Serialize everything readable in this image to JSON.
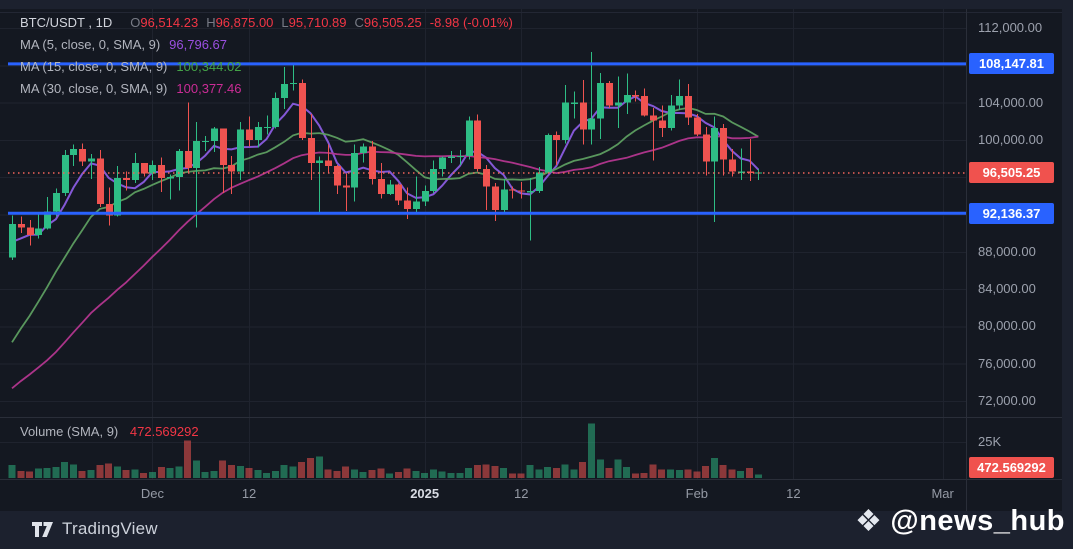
{
  "legend": {
    "symbol_line": "BTC/USDT , 1D",
    "ohlc": {
      "o_key": "O",
      "o": "96,514.23",
      "h_key": "H",
      "h": "96,875.00",
      "l_key": "L",
      "l": "95,710.89",
      "c_key": "C",
      "c": "96,505.25",
      "change": "-8.98 (-0.01%)"
    },
    "ma_rows": [
      {
        "label": "MA (5, close, 0, SMA, 9)",
        "value": "96,796.67",
        "color": "#9a4fe0"
      },
      {
        "label": "MA (15, close, 0, SMA, 9)",
        "value": "100,344.02",
        "color": "#44a248"
      },
      {
        "label": "MA (30, close, 0, SMA, 9)",
        "value": "100,377.46",
        "color": "#cb2c96"
      }
    ]
  },
  "volume_legend": {
    "label": "Volume (SMA, 9)",
    "value": "472.569292"
  },
  "footer": {
    "brand": "TradingView",
    "watermark": "@news_hub"
  },
  "colors": {
    "background": "#141821",
    "outer_background": "#1c212e",
    "grid": "#1f232e",
    "separator": "#2a2e39",
    "candle_up": "#2ebd85",
    "candle_down": "#ef5350",
    "volume_up": "rgba(46,189,133,0.50)",
    "volume_down": "rgba(239,83,80,0.55)",
    "ma5": "#8a5ce0",
    "ma15": "#5d9e61",
    "ma30": "#b3368f",
    "price_line_blue": "#2962ff",
    "last_price_red": "#f0524e",
    "legend_red": "#f23645",
    "axis_text": "#9ca1ad"
  },
  "chart_data": {
    "type": "candlestick+volume",
    "symbol": "BTC/USDT",
    "interval": "1D",
    "note_units": "prices in thousands of USDT; volumes in K",
    "price_axis_visible_range": [
      72000,
      112000
    ],
    "grid_price_levels": [
      112,
      108,
      104,
      100,
      96,
      92,
      88,
      84,
      80,
      76,
      72
    ],
    "price_ticks": [
      {
        "label": "112,000.00",
        "price": 112000
      },
      {
        "label": "104,000.00",
        "price": 104000
      },
      {
        "label": "100,000.00",
        "price": 100000
      },
      {
        "label": "88,000.00",
        "price": 88000
      },
      {
        "label": "84,000.00",
        "price": 84000
      },
      {
        "label": "80,000.00",
        "price": 80000
      },
      {
        "label": "76,000.00",
        "price": 76000
      },
      {
        "label": "72,000.00",
        "price": 72000
      }
    ],
    "price_lines": [
      {
        "label": "108,147.81",
        "price": 108147.81
      },
      {
        "label": "92,136.37",
        "price": 92136.37
      }
    ],
    "last_price": {
      "label": "96,505.25",
      "price": 96505.25
    },
    "volume_axis_tick": {
      "label": "25K",
      "value": 25
    },
    "volume_axis_label": "472.569292",
    "x_ticks": [
      {
        "label": "Dec",
        "i": 16,
        "strong": false
      },
      {
        "label": "12",
        "i": 27,
        "strong": false
      },
      {
        "label": "2025",
        "i": 47,
        "strong": true
      },
      {
        "label": "12",
        "i": 58,
        "strong": false
      },
      {
        "label": "Feb",
        "i": 78,
        "strong": false
      },
      {
        "label": "12",
        "i": 89,
        "strong": false
      },
      {
        "label": "Mar",
        "i": 106,
        "strong": false
      }
    ],
    "ma_periods": [
      5,
      15,
      30
    ],
    "pre_closes": [
      67.6,
      67.4,
      68.4,
      68.4,
      69.0,
      67.4,
      67.4,
      66.7,
      67.0,
      66.6,
      67.9,
      68.2,
      69.9,
      72.3,
      70.2,
      69.5,
      68.7,
      69.3,
      67.8,
      68.8,
      69.4,
      75.6,
      76.0,
      76.7,
      76.5,
      80.4,
      88.7,
      87.9,
      90.4,
      87.3
    ],
    "candles": [
      [
        87.4,
        91.9,
        87.1,
        91.0,
        9
      ],
      [
        91.0,
        91.8,
        90.0,
        90.6,
        5
      ],
      [
        90.6,
        91.4,
        88.7,
        89.8,
        4.5
      ],
      [
        89.8,
        92.0,
        89.4,
        90.5,
        6.5
      ],
      [
        90.5,
        93.9,
        90.4,
        92.3,
        7
      ],
      [
        92.3,
        94.8,
        91.8,
        94.3,
        7.5
      ],
      [
        94.3,
        98.9,
        94.0,
        98.4,
        11
      ],
      [
        98.4,
        99.5,
        97.2,
        99.0,
        9.5
      ],
      [
        99.0,
        99.6,
        97.2,
        97.7,
        5
      ],
      [
        97.7,
        98.5,
        95.8,
        98.0,
        5.5
      ],
      [
        98.0,
        98.9,
        92.8,
        93.1,
        9
      ],
      [
        93.1,
        94.9,
        90.8,
        91.9,
        10
      ],
      [
        91.9,
        97.2,
        91.8,
        95.9,
        8
      ],
      [
        95.9,
        96.6,
        94.6,
        95.7,
        5.5
      ],
      [
        95.7,
        98.6,
        95.4,
        97.5,
        6
      ],
      [
        97.5,
        97.5,
        96.1,
        96.4,
        3.5
      ],
      [
        96.4,
        97.8,
        95.7,
        97.3,
        4
      ],
      [
        97.3,
        98.1,
        94.4,
        95.9,
        7.5
      ],
      [
        95.9,
        96.3,
        93.6,
        96.0,
        7
      ],
      [
        96.0,
        99.0,
        94.6,
        98.8,
        8
      ],
      [
        98.8,
        104.0,
        96.5,
        97.0,
        26
      ],
      [
        97.0,
        101.9,
        90.6,
        99.9,
        12
      ],
      [
        99.9,
        100.4,
        98.8,
        99.9,
        4
      ],
      [
        99.9,
        101.4,
        98.7,
        101.2,
        5
      ],
      [
        101.2,
        101.2,
        94.3,
        97.3,
        12
      ],
      [
        97.3,
        98.3,
        94.2,
        96.6,
        9
      ],
      [
        96.6,
        101.9,
        95.7,
        101.1,
        8.5
      ],
      [
        101.1,
        102.5,
        99.3,
        100.0,
        7
      ],
      [
        100.0,
        101.9,
        99.2,
        101.4,
        5.5
      ],
      [
        101.4,
        102.6,
        100.6,
        101.4,
        3.5
      ],
      [
        101.4,
        105.1,
        101.2,
        104.5,
        5
      ],
      [
        104.5,
        107.8,
        103.3,
        106.0,
        9
      ],
      [
        106.0,
        108.3,
        105.3,
        106.1,
        8
      ],
      [
        106.1,
        106.5,
        100.0,
        100.2,
        11
      ],
      [
        100.2,
        102.8,
        95.7,
        97.5,
        14
      ],
      [
        97.5,
        98.2,
        92.2,
        97.8,
        15
      ],
      [
        97.8,
        99.5,
        96.4,
        97.2,
        6
      ],
      [
        97.2,
        97.3,
        94.2,
        95.1,
        5
      ],
      [
        95.1,
        96.4,
        92.4,
        94.9,
        8
      ],
      [
        94.9,
        99.5,
        93.4,
        98.6,
        6
      ],
      [
        98.6,
        99.6,
        97.6,
        99.3,
        4
      ],
      [
        99.3,
        99.9,
        95.2,
        95.8,
        5.5
      ],
      [
        95.8,
        97.5,
        93.7,
        94.2,
        6.5
      ],
      [
        94.2,
        95.7,
        94.1,
        95.2,
        3
      ],
      [
        95.2,
        95.3,
        93.0,
        93.5,
        4
      ],
      [
        93.5,
        94.9,
        91.5,
        92.6,
        6.5
      ],
      [
        92.6,
        96.1,
        92.0,
        93.4,
        5
      ],
      [
        93.4,
        95.1,
        92.9,
        94.5,
        3.5
      ],
      [
        94.5,
        97.8,
        94.3,
        96.9,
        6
      ],
      [
        96.9,
        98.2,
        96.1,
        98.1,
        4.5
      ],
      [
        98.1,
        98.8,
        97.5,
        98.2,
        3.5
      ],
      [
        98.2,
        98.9,
        97.3,
        98.3,
        3.5
      ],
      [
        98.3,
        102.5,
        97.9,
        102.1,
        7
      ],
      [
        102.1,
        102.7,
        96.6,
        96.9,
        9
      ],
      [
        96.9,
        97.3,
        92.5,
        95.0,
        9.5
      ],
      [
        95.0,
        95.4,
        91.3,
        92.5,
        8.5
      ],
      [
        92.5,
        95.8,
        92.2,
        94.7,
        7
      ],
      [
        94.7,
        95.0,
        93.7,
        94.6,
        3
      ],
      [
        94.6,
        95.5,
        93.7,
        94.5,
        3
      ],
      [
        94.5,
        95.9,
        89.2,
        94.5,
        9
      ],
      [
        94.5,
        97.1,
        94.3,
        96.5,
        6
      ],
      [
        96.5,
        100.7,
        96.4,
        100.5,
        7.5
      ],
      [
        100.5,
        100.9,
        97.3,
        100.0,
        7
      ],
      [
        100.0,
        105.9,
        99.6,
        104.0,
        9.5
      ],
      [
        104.0,
        105.2,
        102.3,
        104.0,
        6
      ],
      [
        104.0,
        106.4,
        99.5,
        101.1,
        11
      ],
      [
        101.1,
        109.4,
        99.5,
        102.3,
        38
      ],
      [
        102.3,
        107.2,
        100.1,
        106.1,
        13
      ],
      [
        106.1,
        106.3,
        103.4,
        103.7,
        7
      ],
      [
        103.7,
        106.8,
        101.3,
        104.0,
        13
      ],
      [
        104.0,
        107.1,
        102.8,
        104.8,
        7.5
      ],
      [
        104.8,
        105.3,
        104.1,
        104.7,
        3
      ],
      [
        104.7,
        105.5,
        102.5,
        102.6,
        3.5
      ],
      [
        102.6,
        103.4,
        97.8,
        102.1,
        9.5
      ],
      [
        102.1,
        103.7,
        100.3,
        101.3,
        6
      ],
      [
        101.3,
        104.8,
        101.0,
        103.7,
        6
      ],
      [
        103.7,
        106.5,
        103.2,
        104.7,
        5.5
      ],
      [
        104.7,
        106.0,
        101.6,
        102.4,
        6
      ],
      [
        102.4,
        102.8,
        100.4,
        100.6,
        4.5
      ],
      [
        100.6,
        101.4,
        96.2,
        97.7,
        8.5
      ],
      [
        97.7,
        102.5,
        91.2,
        101.3,
        14
      ],
      [
        101.3,
        101.7,
        96.2,
        97.9,
        9
      ],
      [
        97.9,
        99.0,
        96.1,
        96.6,
        6
      ],
      [
        96.6,
        99.1,
        95.7,
        96.6,
        5
      ],
      [
        96.6,
        100.1,
        95.6,
        96.5,
        7
      ],
      [
        96.5,
        96.9,
        95.7,
        96.5,
        2.5
      ]
    ]
  }
}
